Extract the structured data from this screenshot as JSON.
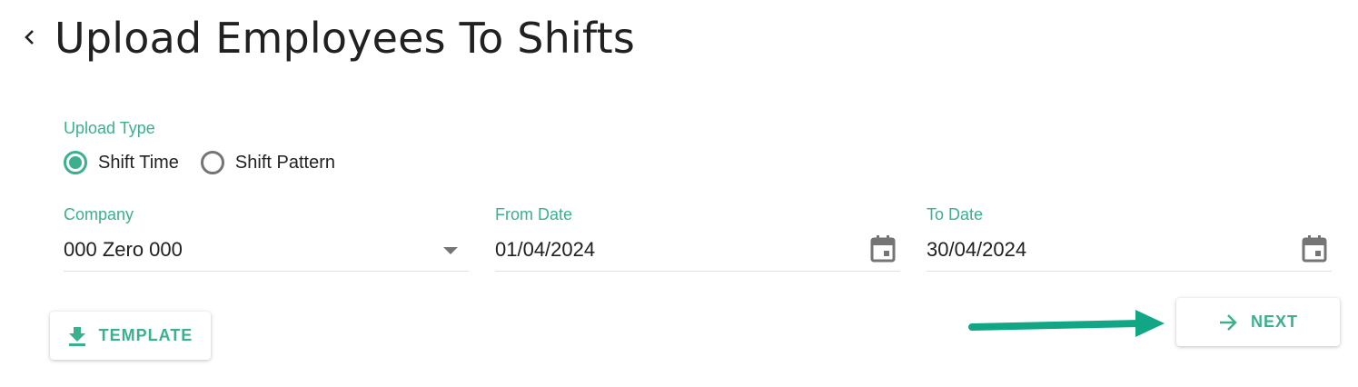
{
  "header": {
    "title": "Upload Employees To Shifts",
    "back_icon": "chevron-left-icon"
  },
  "upload_type": {
    "label": "Upload Type",
    "options": [
      {
        "label": "Shift Time",
        "selected": true
      },
      {
        "label": "Shift Pattern",
        "selected": false
      }
    ]
  },
  "fields": {
    "company": {
      "label": "Company",
      "value": "000 Zero 000"
    },
    "from_date": {
      "label": "From Date",
      "value": "01/04/2024"
    },
    "to_date": {
      "label": "To Date",
      "value": "30/04/2024"
    }
  },
  "actions": {
    "template_label": "TEMPLATE",
    "template_icon": "download-icon",
    "next_label": "NEXT",
    "next_icon": "arrow-right-icon"
  },
  "colors": {
    "accent": "#3bb08f",
    "annotation_arrow": "#12a784",
    "text": "#212121",
    "icon_gray": "#757575"
  }
}
